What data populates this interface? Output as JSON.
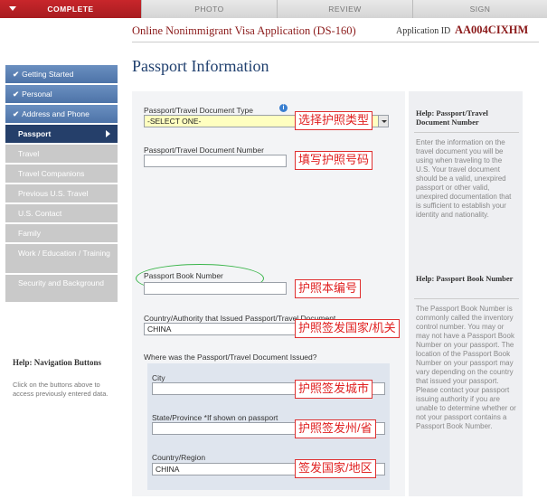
{
  "tabs": {
    "complete": "COMPLETE",
    "photo": "PHOTO",
    "review": "REVIEW",
    "sign": "SIGN"
  },
  "header": {
    "title": "Online Nonimmigrant Visa Application (DS-160)",
    "app_id_label": "Application ID",
    "app_id": "AA004CIXHM"
  },
  "sidebar": {
    "items": [
      {
        "label": "Getting Started"
      },
      {
        "label": "Personal"
      },
      {
        "label": "Address and Phone"
      },
      {
        "label": "Passport"
      },
      {
        "label": "Travel"
      },
      {
        "label": "Travel Companions"
      },
      {
        "label": "Previous U.S. Travel"
      },
      {
        "label": "U.S. Contact"
      },
      {
        "label": "Family"
      },
      {
        "label": "Work / Education / Training"
      },
      {
        "label": "Security and Background"
      }
    ],
    "help_title": "Help: Navigation Buttons",
    "help_text": "Click on the buttons above to access previously entered data."
  },
  "page_title": "Passport Information",
  "form": {
    "doc_type_label": "Passport/Travel Document Type",
    "doc_type_value": "-SELECT ONE-",
    "doc_number_label": "Passport/Travel Document Number",
    "doc_number_value": "",
    "book_number_label": "Passport Book Number",
    "book_number_value": "",
    "issuing_country_label": "Country/Authority that Issued Passport/Travel Document",
    "issuing_country_value": "CHINA",
    "where_issued_label": "Where was the Passport/Travel Document Issued?",
    "city_label": "City",
    "city_value": "",
    "state_label": "State/Province *If shown on passport",
    "state_value": "",
    "country_label": "Country/Region",
    "country_value": "CHINA"
  },
  "annotations": {
    "doc_type": "选择护照类型",
    "doc_number": "填写护照号码",
    "book_number": "护照本编号",
    "issuing_country": "护照签发国家/机关",
    "city": "护照签发城市",
    "state": "护照签发州/省",
    "country": "签发国家/地区"
  },
  "help": {
    "doc_title": "Help: Passport/Travel Document Number",
    "doc_text": "Enter the information on the travel document you will be using when traveling to the U.S. Your travel document should be a valid, unexpired passport or other valid, unexpired documentation that is sufficient to establish your identity and nationality.",
    "book_title": "Help: Passport Book Number",
    "book_text": "The Passport Book Number is commonly called the inventory control number. You may or may not have a Passport Book Number on your passport. The location of the Passport Book Number on your passport may vary depending on the country that issued your passport. Please contact your passport issuing authority if you are unable to determine whether or not your passport contains a Passport Book Number."
  },
  "colors": {
    "complete_tab": "#b8232a",
    "nav_done": "#5a80b4",
    "nav_current": "#253f6a",
    "nav_todo": "#c9c9c9",
    "annotation_red": "#e03030",
    "oval_green": "#3ab54a",
    "title_blue": "#1f3f6e"
  }
}
